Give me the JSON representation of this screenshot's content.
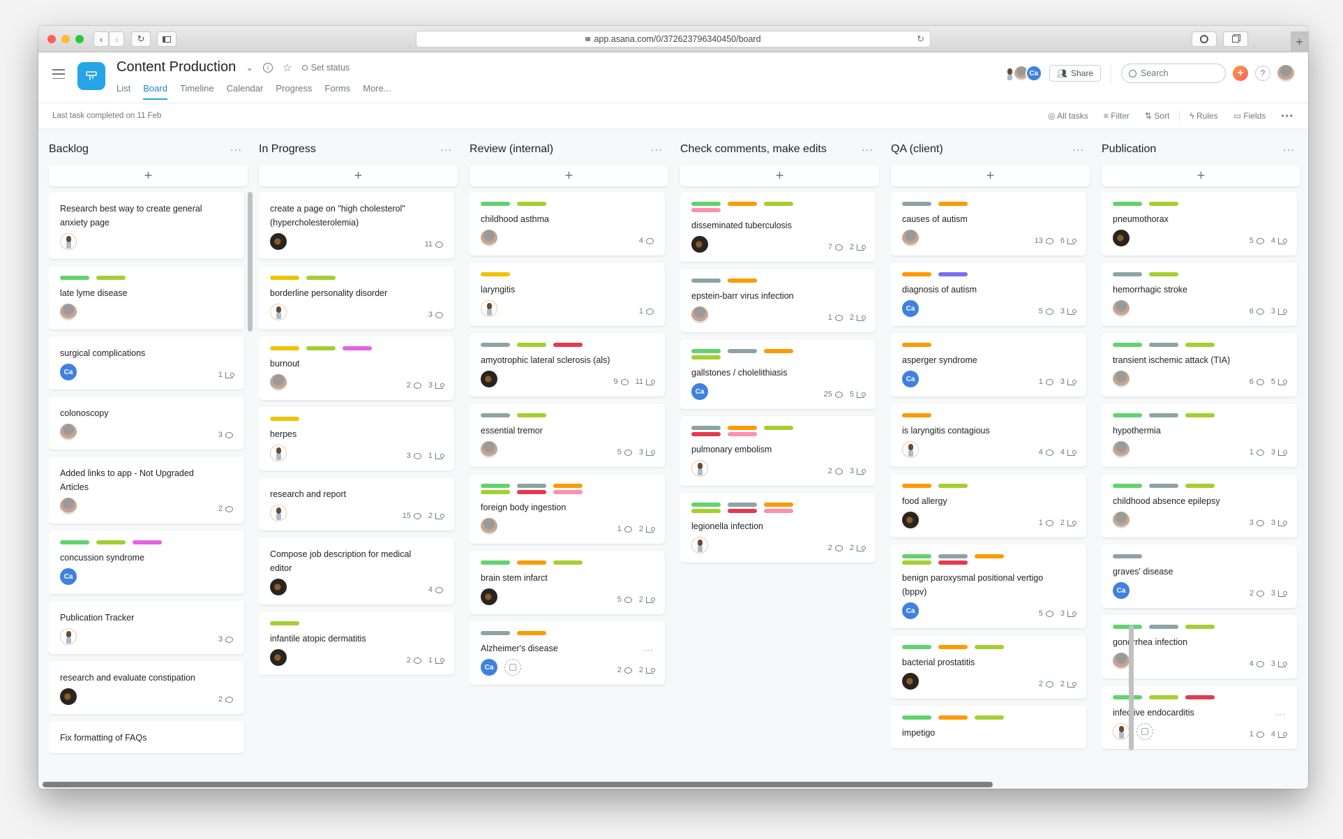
{
  "browser": {
    "url": "app.asana.com/0/372623796340450/board",
    "lock_icon": "lock-icon",
    "new_tab_label": "+"
  },
  "header": {
    "project_title": "Content Production",
    "set_status_label": "Set status",
    "tabs": [
      {
        "label": "List",
        "active": false
      },
      {
        "label": "Board",
        "active": true
      },
      {
        "label": "Timeline",
        "active": false
      },
      {
        "label": "Calendar",
        "active": false
      },
      {
        "label": "Progress",
        "active": false
      },
      {
        "label": "Forms",
        "active": false
      },
      {
        "label": "More...",
        "active": false
      }
    ],
    "members_avatar_initials": "Ca",
    "share_label": "Share",
    "search_placeholder": "Search",
    "help_label": "?"
  },
  "toolbar": {
    "last_completed": "Last task completed on 11 Feb",
    "all_tasks": "All tasks",
    "filter": "Filter",
    "sort": "Sort",
    "rules": "Rules",
    "fields": "Fields"
  },
  "tag_colors": {
    "green": "#62d26f",
    "lime": "#a4cf30",
    "yellow": "#eec300",
    "magenta": "#e362e3",
    "gray": "#8da3a6",
    "orange": "#fd9a00",
    "red": "#e8384f",
    "pink": "#fc91ad",
    "purple": "#7a6ff0"
  },
  "columns": [
    {
      "title": "Backlog",
      "cards": [
        {
          "title": "Research best way to create general anxiety page",
          "tags": [],
          "assignee": "bald",
          "comments": null,
          "subtasks": null
        },
        {
          "title": "late lyme disease",
          "tags": [
            "green",
            "lime"
          ],
          "assignee": "gray",
          "comments": null,
          "subtasks": null
        },
        {
          "title": "surgical complications",
          "tags": [],
          "assignee": "Ca",
          "comments": null,
          "subtasks": "1"
        },
        {
          "title": "colonoscopy",
          "tags": [],
          "assignee": "gray",
          "comments": "3",
          "subtasks": null
        },
        {
          "title": "Added links to app - Not Upgraded Articles",
          "tags": [],
          "assignee": "gray",
          "comments": "2",
          "subtasks": null
        },
        {
          "title": "concussion syndrome",
          "tags": [
            "green",
            "lime",
            "magenta"
          ],
          "assignee": "Ca",
          "comments": null,
          "subtasks": null
        },
        {
          "title": "Publication Tracker",
          "tags": [],
          "assignee": "bald",
          "comments": "3",
          "subtasks": null
        },
        {
          "title": "research and evaluate constipation",
          "tags": [],
          "assignee": "dark",
          "comments": "2",
          "subtasks": null
        },
        {
          "title": "Fix formatting of FAQs",
          "tags": [],
          "assignee": null,
          "comments": null,
          "subtasks": null
        }
      ]
    },
    {
      "title": "In Progress",
      "cards": [
        {
          "title": "create a page on \"high cholesterol\" (hypercholesterolemia)",
          "tags": [],
          "assignee": "dark",
          "comments": "11",
          "subtasks": null
        },
        {
          "title": "borderline personality disorder",
          "tags": [
            "yellow",
            "lime"
          ],
          "assignee": "bald",
          "comments": "3",
          "subtasks": null
        },
        {
          "title": "burnout",
          "tags": [
            "yellow",
            "lime",
            "magenta"
          ],
          "assignee": "gray",
          "comments": "2",
          "subtasks": "3"
        },
        {
          "title": "herpes",
          "tags": [
            "yellow"
          ],
          "assignee": "bald",
          "comments": "3",
          "subtasks": "1"
        },
        {
          "title": "research and report",
          "tags": [],
          "assignee": "bald",
          "comments": "15",
          "subtasks": "2"
        },
        {
          "title": "Compose job description for medical editor",
          "tags": [],
          "assignee": "dark",
          "comments": "4",
          "subtasks": null
        },
        {
          "title": "infantile atopic dermatitis",
          "tags": [
            "lime"
          ],
          "assignee": "dark",
          "comments": "2",
          "subtasks": "1"
        }
      ]
    },
    {
      "title": "Review (internal)",
      "cards": [
        {
          "title": "childhood asthma",
          "tags": [
            "green",
            "lime"
          ],
          "assignee": "gray",
          "comments": "4",
          "subtasks": null
        },
        {
          "title": "laryngitis",
          "tags": [
            "yellow"
          ],
          "assignee": "bald",
          "comments": "1",
          "subtasks": null
        },
        {
          "title": "amyotrophic lateral sclerosis (als)",
          "tags": [
            "gray",
            "lime",
            "red"
          ],
          "assignee": "dark",
          "comments": "9",
          "subtasks": "11"
        },
        {
          "title": "essential tremor",
          "tags": [
            "gray",
            "lime"
          ],
          "assignee": "gray",
          "comments": "5",
          "subtasks": "3"
        },
        {
          "title": "foreign body ingestion",
          "tags": [
            "green",
            "gray",
            "orange",
            "lime",
            "red",
            "pink"
          ],
          "assignee": "gray",
          "comments": "1",
          "subtasks": "2"
        },
        {
          "title": "brain stem infarct",
          "tags": [
            "green",
            "orange",
            "lime"
          ],
          "assignee": "dark",
          "comments": "5",
          "subtasks": "2"
        },
        {
          "title": "Alzheimer's disease",
          "tags": [
            "gray",
            "orange"
          ],
          "assignee": "Ca",
          "due_date_placeholder": true,
          "hover_menu": true,
          "comments": "2",
          "subtasks": "2"
        }
      ]
    },
    {
      "title": "Check comments, make edits",
      "cards": [
        {
          "title": "disseminated tuberculosis",
          "tags": [
            "green",
            "orange",
            "lime",
            "pink"
          ],
          "assignee": "dark",
          "comments": "7",
          "subtasks": "2"
        },
        {
          "title": "epstein-barr virus infection",
          "tags": [
            "gray",
            "orange"
          ],
          "assignee": "gray",
          "comments": "1",
          "subtasks": "2"
        },
        {
          "title": "gallstones / cholelithiasis",
          "tags": [
            "green",
            "gray",
            "orange",
            "lime"
          ],
          "assignee": "Ca",
          "comments": "25",
          "subtasks": "5"
        },
        {
          "title": "pulmonary embolism",
          "tags": [
            "gray",
            "orange",
            "lime",
            "red",
            "pink"
          ],
          "assignee": "bald",
          "comments": "2",
          "subtasks": "3"
        },
        {
          "title": "legionella infection",
          "tags": [
            "green",
            "gray",
            "orange",
            "lime",
            "red",
            "pink"
          ],
          "assignee": "bald",
          "comments": "2",
          "subtasks": "2"
        }
      ]
    },
    {
      "title": "QA (client)",
      "cards": [
        {
          "title": "causes of autism",
          "tags": [
            "gray",
            "orange"
          ],
          "assignee": "gray",
          "comments": "13",
          "subtasks": "6"
        },
        {
          "title": "diagnosis of autism",
          "tags": [
            "orange",
            "purple"
          ],
          "assignee": "Ca",
          "comments": "5",
          "subtasks": "3"
        },
        {
          "title": "asperger syndrome",
          "tags": [
            "orange"
          ],
          "assignee": "Ca",
          "comments": "1",
          "subtasks": "3"
        },
        {
          "title": "is laryngitis contagious",
          "tags": [
            "orange"
          ],
          "assignee": "bald",
          "comments": "4",
          "subtasks": "4"
        },
        {
          "title": "food allergy",
          "tags": [
            "orange",
            "lime"
          ],
          "assignee": "dark",
          "comments": "1",
          "subtasks": "2"
        },
        {
          "title": "benign paroxysmal positional vertigo (bppv)",
          "tags": [
            "green",
            "gray",
            "orange",
            "lime",
            "red"
          ],
          "assignee": "Ca",
          "comments": "5",
          "subtasks": "3"
        },
        {
          "title": "bacterial prostatitis",
          "tags": [
            "green",
            "orange",
            "lime"
          ],
          "assignee": "dark",
          "comments": "2",
          "subtasks": "2"
        },
        {
          "title": "impetigo",
          "tags": [
            "green",
            "orange",
            "lime"
          ],
          "assignee": null,
          "comments": null,
          "subtasks": null
        }
      ]
    },
    {
      "title": "Publication",
      "cards": [
        {
          "title": "pneumothorax",
          "tags": [
            "green",
            "lime"
          ],
          "assignee": "dark",
          "comments": "5",
          "subtasks": "4"
        },
        {
          "title": "hemorrhagic stroke",
          "tags": [
            "gray",
            "lime"
          ],
          "assignee": "gray",
          "comments": "6",
          "subtasks": "3"
        },
        {
          "title": "transient ischemic attack (TIA)",
          "tags": [
            "green",
            "gray",
            "lime"
          ],
          "assignee": "gray",
          "comments": "6",
          "subtasks": "5"
        },
        {
          "title": "hypothermia",
          "tags": [
            "green",
            "gray",
            "lime"
          ],
          "assignee": "gray",
          "comments": "1",
          "subtasks": "3"
        },
        {
          "title": "childhood absence epilepsy",
          "tags": [
            "green",
            "gray",
            "lime"
          ],
          "assignee": "gray",
          "comments": "3",
          "subtasks": "3"
        },
        {
          "title": "graves' disease",
          "tags": [
            "gray"
          ],
          "assignee": "Ca",
          "comments": "2",
          "subtasks": "3"
        },
        {
          "title": "gonorrhea infection",
          "tags": [
            "green",
            "gray",
            "lime"
          ],
          "assignee": "gray",
          "comments": "4",
          "subtasks": "3"
        },
        {
          "title": "infective endocarditis",
          "tags": [
            "green",
            "lime",
            "red"
          ],
          "assignee": "bald",
          "due_date_placeholder": true,
          "hover_menu": true,
          "comments": "1",
          "subtasks": "4"
        }
      ]
    }
  ]
}
